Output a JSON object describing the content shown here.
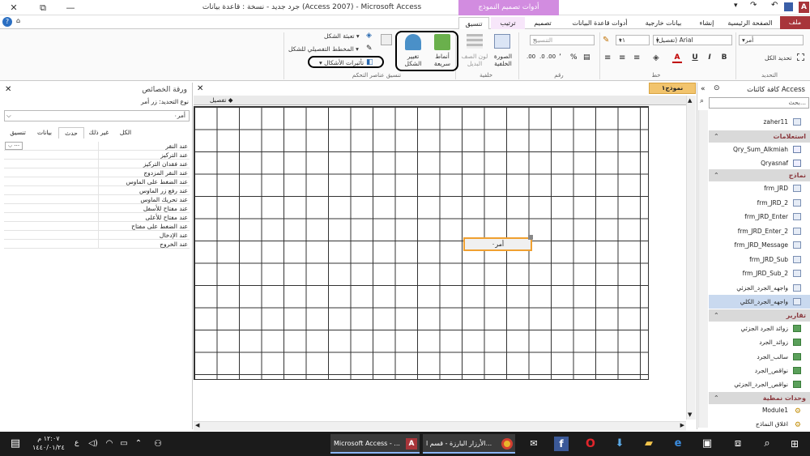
{
  "window": {
    "title": "جرد جديد - نسخة : قاعدة بيانات (Access 2007) - Microsoft Access",
    "context_tab_title": "أدوات تصميم النموذج",
    "close_glyph": "✕",
    "restore_glyph": "⧉",
    "minimize_glyph": "—"
  },
  "tabs": {
    "file": "ملف",
    "home": "الصفحة الرئيسية",
    "create": "إنشاء",
    "external": "بيانات خارجية",
    "dbtools": "أدوات قاعدة البيانات",
    "design": "تصميم",
    "arrange": "ترتيب",
    "format": "تنسيق"
  },
  "ribbon": {
    "select_all": "تحديد الكل",
    "object_combo": "أمر٠",
    "group_selection": "التحديد",
    "font_name": "(تفصيل) Arial",
    "font_size": "١١",
    "format_combo": "التنسيق",
    "bold": "B",
    "italic": "I",
    "underline": "U",
    "font_color": "A",
    "group_font": "خط",
    "group_number": "رقم",
    "percent": "%",
    "comma": "٬",
    "bg_image": "الصورة الخلفية",
    "alt_row_color": "لون الصف البديل",
    "group_background": "خلفية",
    "quick_styles": "أنماط سريعة",
    "change_shape": "تغيير الشكل",
    "group_controls": "تنسيق عناصر التحكم",
    "shape_fill": "تعبئة الشكل",
    "shape_outline": "المخطط التفصيلي للشكل",
    "shape_effects": "تأثيرات الأشكال"
  },
  "properties": {
    "title": "ورقة الخصائص",
    "selection_type": "نوع التحديد: زر أمر",
    "selected_object": "أمر٠",
    "tabs": [
      "الكل",
      "غير ذلك",
      "حدث",
      "بيانات",
      "تنسيق"
    ],
    "rows": [
      "عند النقر",
      "عند التركيز",
      "عند فقدان التركيز",
      "عند النقر المزدوج",
      "عند الضغط على الماوس",
      "عند رفع زر الماوس",
      "عند تحريك الماوس",
      "عند مفتاح للأسفل",
      "عند مفتاح للأعلى",
      "عند الضغط على مفتاح",
      "عند الإدخال",
      "عند الخروج"
    ]
  },
  "document": {
    "tab_label": "نموذج١",
    "section_label": "تفصيل",
    "button_caption": "أمر٠"
  },
  "nav": {
    "title": "كافة كائنات Access",
    "search_placeholder": "بحث...",
    "tables": [
      "zaher11"
    ],
    "queries_header": "استعلامات",
    "queries": [
      "Qry_Sum_Alkmiah",
      "Qryasnaf"
    ],
    "forms_header": "نماذج",
    "forms": [
      "frm_JRD",
      "frm_JRD_2",
      "frm_JRD_Enter",
      "frm_JRD_Enter_2",
      "frm_JRD_Message",
      "frm_JRD_Sub",
      "frm_JRD_Sub_2",
      "واجهه_الجرد_الجزئي",
      "واجهه_الجرد_الكلي"
    ],
    "reports_header": "تقارير",
    "reports": [
      "زوائد الجرد الجزئي",
      "زوائد_الجرد",
      "سالب_الجرد",
      "نواقص_الجرد",
      "نواقص_الجرد_الجزئي"
    ],
    "macros_header": "وحدات نمطية",
    "macros": [
      "Module1",
      "اغلاق النماذج"
    ]
  },
  "taskbar": {
    "time": "١٢:٠٧ م",
    "date": "١٤٤٠/٠١/٢٤",
    "lang": "ع",
    "app_access": "Microsoft Access - ...",
    "app_chrome": "الأرزار البارزة - قسم ا..."
  }
}
